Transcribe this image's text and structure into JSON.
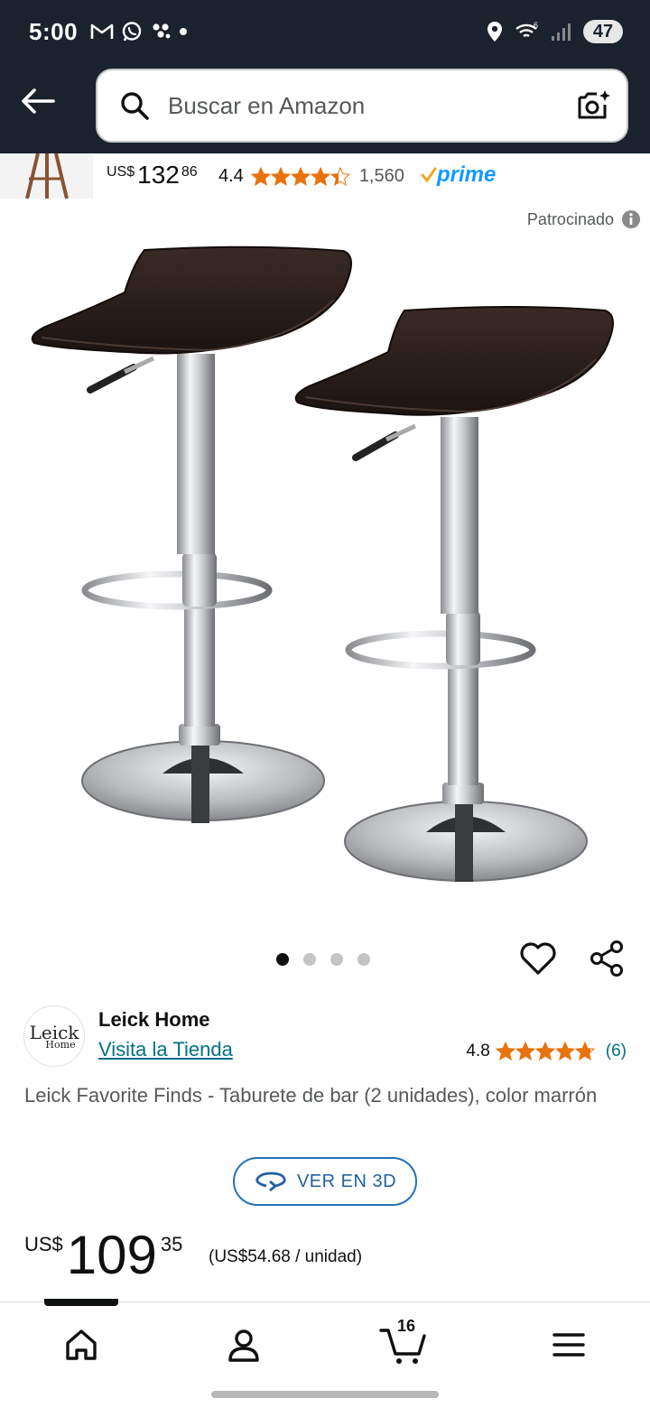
{
  "status": {
    "time": "5:00",
    "battery": "47"
  },
  "search": {
    "placeholder": "Buscar en Amazon"
  },
  "ad": {
    "currency": "US$",
    "price_whole": "132",
    "price_fraction": "86",
    "rating": "4.4",
    "rating_stars": 4.4,
    "review_count": "1,560",
    "prime_label": "prime"
  },
  "sponsored_label": "Patrocinado",
  "gallery": {
    "image_count": 4,
    "active_index": 0
  },
  "seller": {
    "logo_line1": "Leick",
    "logo_line2": "Home",
    "name": "Leick Home",
    "store_link": "Visita la Tienda",
    "rating": "4.8",
    "rating_stars": 4.8,
    "rating_count": "(6)"
  },
  "product": {
    "title": "Leick Favorite Finds - Taburete de bar (2 unidades), color marrón",
    "view3d_label": "VER EN 3D",
    "currency": "US$",
    "price_whole": "109",
    "price_fraction": "35",
    "unit_price": "(US$54.68 / unidad)"
  },
  "nav": {
    "cart_count": "16",
    "active": "home"
  },
  "colors": {
    "header_bg": "#19222d",
    "link": "#007185",
    "star": "#e8730c",
    "prime": "#1399ff",
    "button_border": "#2472b6"
  }
}
